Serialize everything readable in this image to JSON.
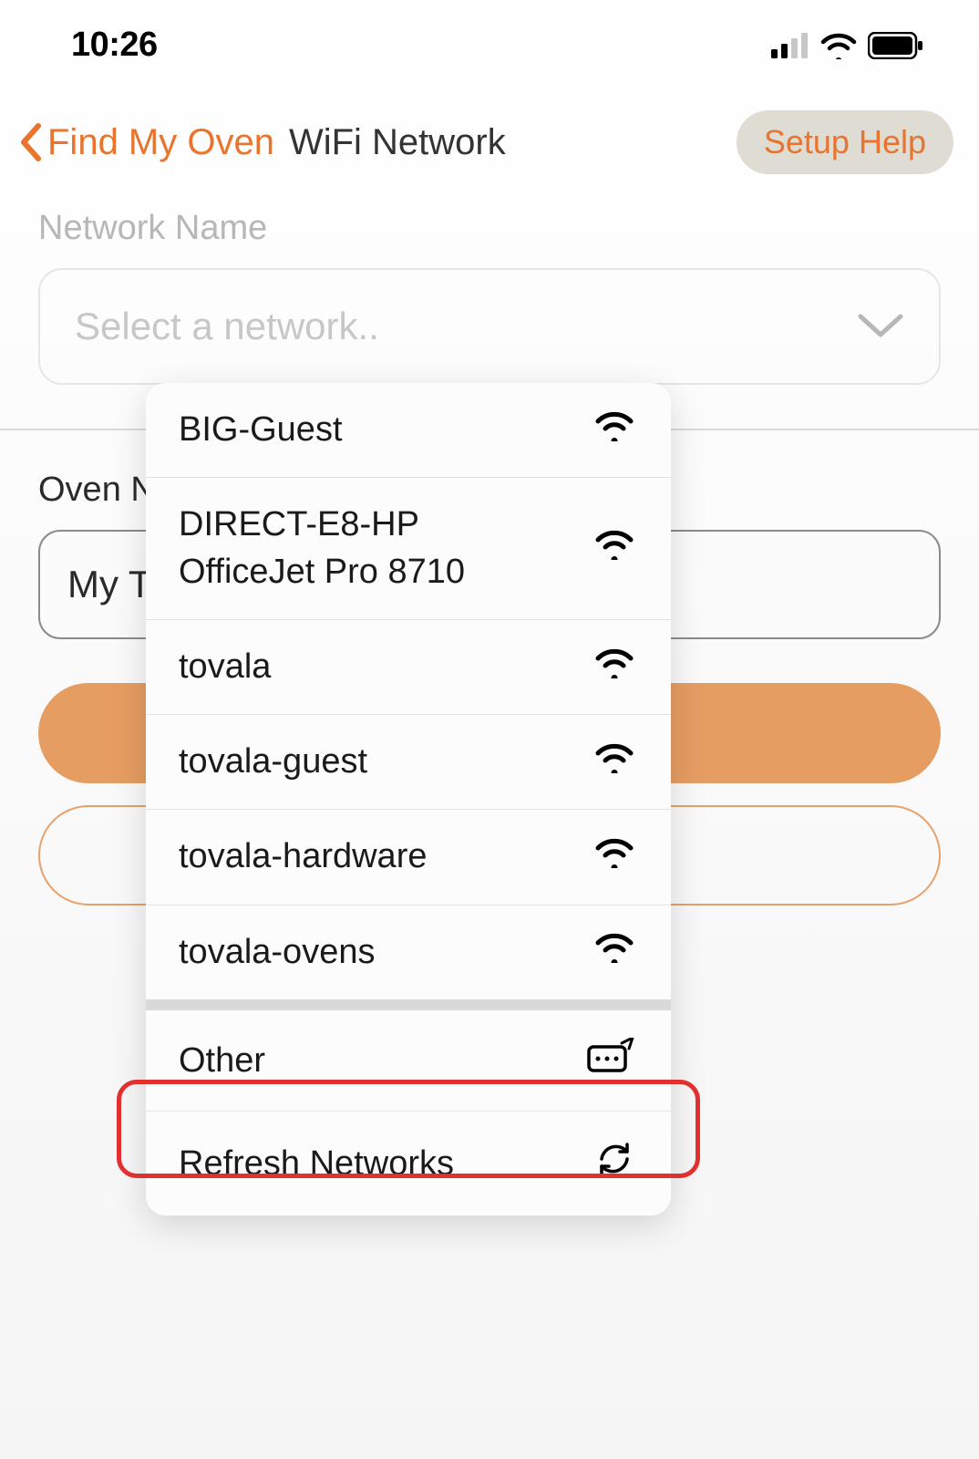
{
  "statusBar": {
    "time": "10:26"
  },
  "nav": {
    "backLabel": "Find My Oven",
    "title": "WiFi Network",
    "helpLabel": "Setup Help"
  },
  "network": {
    "label": "Network Name",
    "placeholder": "Select a network.."
  },
  "oven": {
    "label": "Oven Na",
    "value": "My T"
  },
  "dropdown": {
    "networks": [
      {
        "name": "BIG-Guest"
      },
      {
        "name": "DIRECT-E8-HP OfficeJet Pro 8710"
      },
      {
        "name": "tovala"
      },
      {
        "name": "tovala-guest"
      },
      {
        "name": "tovala-hardware"
      },
      {
        "name": "tovala-ovens"
      }
    ],
    "other": "Other",
    "refresh": "Refresh Networks"
  }
}
